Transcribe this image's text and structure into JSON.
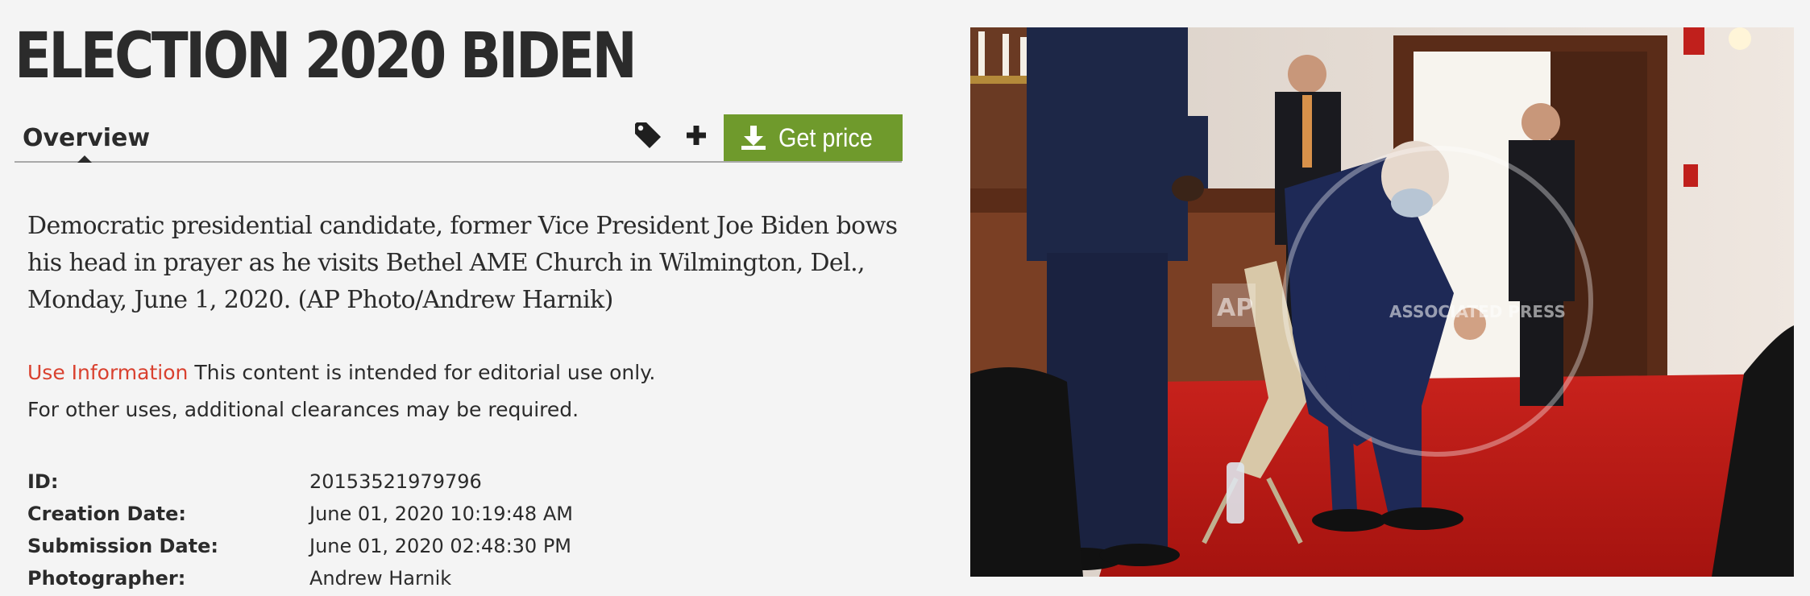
{
  "page": {
    "title": "ELECTION 2020 BIDEN"
  },
  "tabs": {
    "overview_label": "Overview"
  },
  "toolbar": {
    "tag_icon": "tag-icon",
    "plus_icon": "plus-icon",
    "get_price_icon": "download-icon",
    "get_price_label": "Get price",
    "get_price_color": "#6f9a2c"
  },
  "caption": "Democratic presidential candidate, former Vice President Joe Biden bows his head in prayer as he visits Bethel AME Church in Wilmington, Del., Monday, June 1, 2020. (AP Photo/Andrew Harnik)",
  "use_information": {
    "link_label": "Use Information",
    "link_color": "#d9412f",
    "line1": "This content is intended for editorial use only.",
    "line2": "For other uses, additional clearances may be required."
  },
  "metadata": [
    {
      "key": "ID:",
      "value": "20153521979796"
    },
    {
      "key": "Creation Date:",
      "value": "June 01, 2020 10:19:48 AM"
    },
    {
      "key": "Submission Date:",
      "value": "June 01, 2020 02:48:30 PM"
    },
    {
      "key": "Photographer:",
      "value": "Andrew Harnik"
    }
  ],
  "photo": {
    "watermark_logo": "AP",
    "watermark_text": "ASSOCIATED PRESS"
  }
}
